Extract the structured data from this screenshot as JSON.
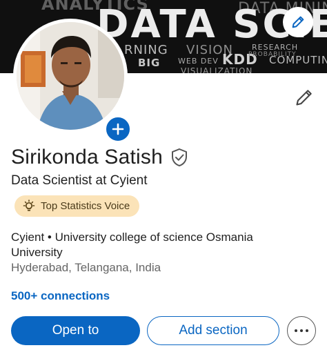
{
  "banner": {
    "title": "DATA SCIENCE",
    "words": [
      "ANALYTICS",
      "RNING",
      "VISION",
      "KDD",
      "RESEARCH",
      "BIG",
      "WEB DEV",
      "PROBABILITY",
      "COMPUTING",
      "DATA MINING",
      "VISUALIZATION"
    ]
  },
  "profile": {
    "name": "Sirikonda Satish",
    "headline": "Data Scientist at Cyient",
    "badge": "Top Statistics Voice",
    "company": "Cyient • University college of science Osmania University",
    "location": "Hyderabad, Telangana, India",
    "connections": "500+ connections"
  },
  "actions": {
    "primary": "Open to",
    "secondary": "Add section"
  },
  "colors": {
    "accent": "#0a66c2",
    "badge_bg": "#fbe3b8"
  },
  "icons": {
    "banner_edit": "pencil-icon",
    "avatar_add": "plus-icon",
    "profile_edit": "pencil-icon",
    "verified": "shield-check-icon",
    "badge": "lightbulb-icon",
    "more": "ellipsis-icon"
  }
}
